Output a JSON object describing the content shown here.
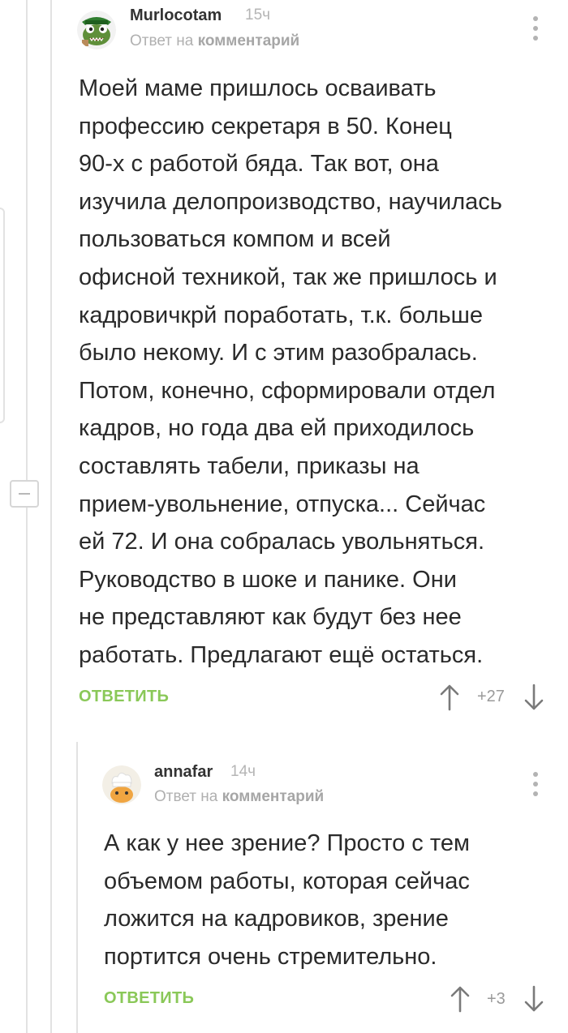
{
  "thread": {
    "collapse_icon": "minus-icon"
  },
  "comments": [
    {
      "author": "Murlocotam",
      "time": "15ч",
      "reply_prefix": "Ответ на",
      "reply_link": "комментарий",
      "text": "Моей маме пришлось осваивать\nпрофессию секретаря в 50. Конец\n90-х с работой бяда. Так вот, она\nизучила делопроизводство, научилась\nпользоваться компом и всей\nофисной техникой, так же пришлось и\nкадровичкрй поработать, т.к. больше\nбыло некому. И с этим разобралась.\nПотом, конечно, сформировали отдел\nкадров, но года два ей приходилось\nсоставлять табели, приказы на\nприем-увольнение, отпуска... Сейчас\nей 72. И она собралась увольняться.\nРуководство в шоке и панике. Они\nне представляют как будут без нее\nработать. Предлагают ещё остаться.",
      "reply_label": "ОТВЕТИТЬ",
      "score": "+27",
      "avatar_icon": "murloc-avatar",
      "more_icon": "more-vertical-icon",
      "up_icon": "arrow-up-icon",
      "down_icon": "arrow-down-icon"
    },
    {
      "author": "annafar",
      "time": "14ч",
      "reply_prefix": "Ответ на",
      "reply_link": "комментарий",
      "text": "А как у нее зрение? Просто с тем\nобъемом работы, которая сейчас\nложится на кадровиков, зрение\nпортится очень стремительно.",
      "reply_label": "ОТВЕТИТЬ",
      "score": "+3",
      "avatar_icon": "chef-avatar",
      "more_icon": "more-vertical-icon",
      "up_icon": "arrow-up-icon",
      "down_icon": "arrow-down-icon"
    }
  ],
  "colors": {
    "reply_green": "#8ac858",
    "muted": "#b0b0b0",
    "thread_line": "#e2e2e2"
  }
}
